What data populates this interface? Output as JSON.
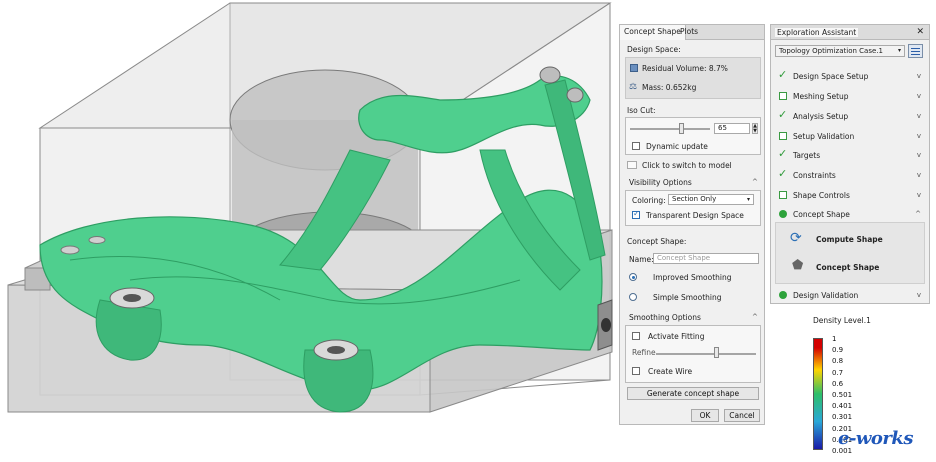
{
  "concept_panel": {
    "tabs": [
      "Concept Shape",
      "Plots"
    ],
    "design_space_label": "Design Space:",
    "residual_volume": "Residual Volume: 8.7%",
    "mass": "Mass: 0.652kg",
    "iso_cut_label": "Iso Cut:",
    "iso_cut_value": "65",
    "iso_cut_fraction": 0.65,
    "dynamic_update": "Dynamic update",
    "switch_to_model": "Click to switch to model",
    "visibility_options": "Visibility Options",
    "coloring_label": "Coloring:",
    "coloring_value": "Section Only",
    "transparent_design_space": "Transparent Design Space",
    "concept_shape_label": "Concept Shape:",
    "name_label": "Name:",
    "name_placeholder": "Concept Shape",
    "improved_smoothing": "Improved Smoothing",
    "simple_smoothing": "Simple Smoothing",
    "smoothing_options": "Smoothing Options",
    "activate_fitting": "Activate Fitting",
    "refine_label": "Refine",
    "refine_fraction": 0.6,
    "create_wire": "Create Wire",
    "generate_button": "Generate concept shape",
    "ok_button": "OK",
    "cancel_button": "Cancel"
  },
  "assistant": {
    "title": "Exploration Assistant",
    "close": "✕",
    "case_select": "Topology Optimization Case.1",
    "steps": [
      {
        "label": "Design Space Setup",
        "state": "done"
      },
      {
        "label": "Meshing Setup",
        "state": "todo"
      },
      {
        "label": "Analysis Setup",
        "state": "done"
      },
      {
        "label": "Setup Validation",
        "state": "todo"
      },
      {
        "label": "Targets",
        "state": "done"
      },
      {
        "label": "Constraints",
        "state": "done"
      },
      {
        "label": "Shape Controls",
        "state": "todo"
      },
      {
        "label": "Concept Shape",
        "state": "active"
      },
      {
        "label": "Design Validation",
        "state": "active"
      }
    ],
    "compute_shape": "Compute Shape",
    "concept_shape": "Concept Shape"
  },
  "legend": {
    "title": "Density Level.1",
    "ticks": [
      "1",
      "0.9",
      "0.8",
      "0.7",
      "0.6",
      "0.501",
      "0.401",
      "0.301",
      "0.201",
      "0.101",
      "0.001"
    ],
    "colors": {
      "top": "#d40000",
      "upper": "#ffd400",
      "mid": "#2dbf6a",
      "lower": "#2aa8d8",
      "bottom": "#1a1aa8"
    }
  },
  "watermark": "e-works",
  "colors": {
    "shape": "#4fcf8e",
    "shape_dark": "#2e9e63",
    "panel_bg": "#f0f0f0",
    "accent": "#2b6fb5"
  }
}
